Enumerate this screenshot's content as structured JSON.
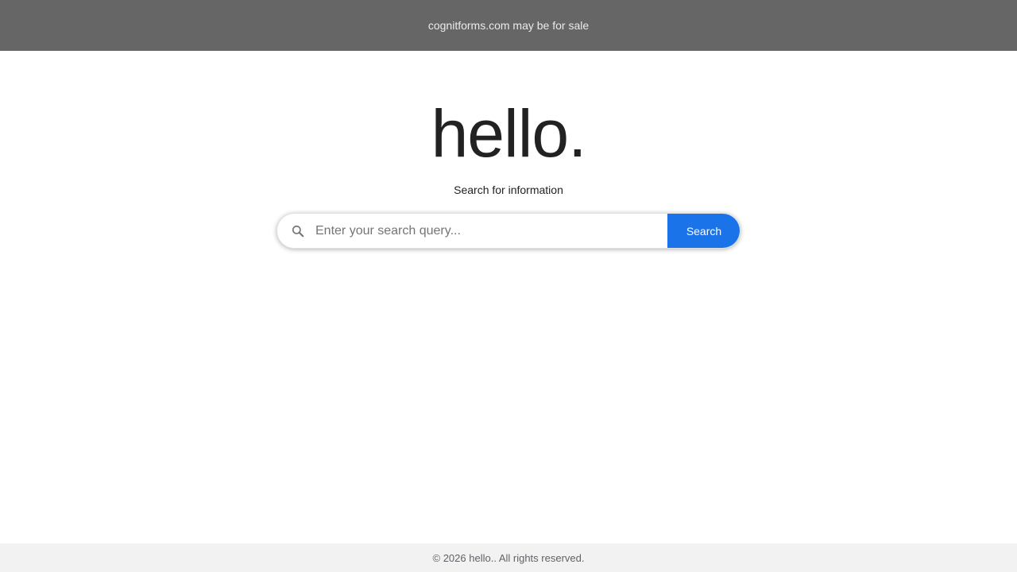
{
  "banner": {
    "text": "cognitforms.com may be for sale"
  },
  "hero": {
    "title": "hello.",
    "subtitle": "Search for information"
  },
  "search": {
    "icon": "search-icon",
    "placeholder": "Enter your search query...",
    "value": "",
    "button_label": "Search"
  },
  "footer": {
    "text": "© 2026 hello.. All rights reserved."
  },
  "colors": {
    "banner_bg": "#666666",
    "accent": "#1a73e8",
    "footer_bg": "#f2f2f2"
  }
}
